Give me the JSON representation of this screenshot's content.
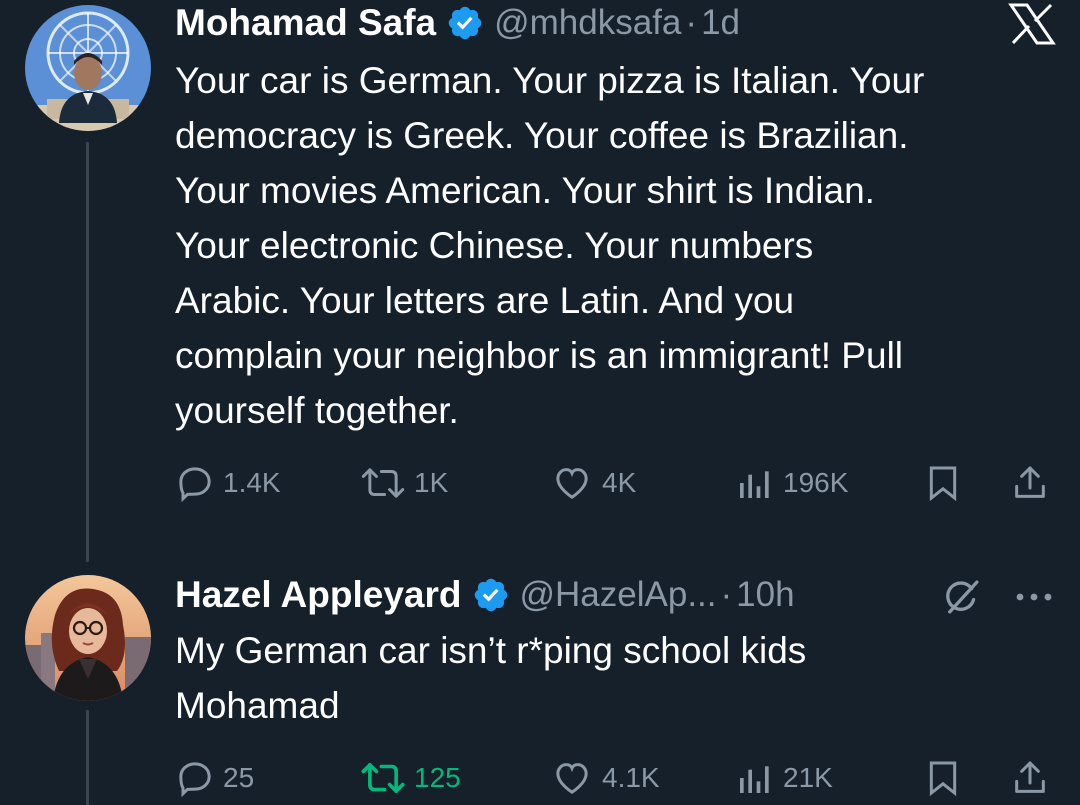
{
  "tweet1": {
    "author_name": "Mohamad Safa",
    "handle": "@mhdksafa",
    "separator": "·",
    "time": "1d",
    "text": "Your car is German. Your pizza is Italian. Your\ndemocracy is Greek. Your coffee is Brazilian.\nYour movies American. Your shirt is Indian.\nYour electronic Chinese. Your numbers\nArabic. Your letters are Latin. And you\ncomplain your neighbor is an immigrant! Pull\nyourself together.",
    "replies": "1.4K",
    "reposts": "1K",
    "likes": "4K",
    "views": "196K",
    "top_right_icon": "x-logo-icon"
  },
  "tweet2": {
    "author_name": "Hazel Appleyard",
    "handle": "@HazelAp...",
    "separator": "·",
    "time": "10h",
    "text": "My German car isn’t r*ping school kids\nMohamad",
    "replies": "25",
    "reposts": "125",
    "likes": "4.1K",
    "views": "21K",
    "reposted_state_color": "#00ba7c",
    "header_icons": [
      "grok-slash-icon",
      "more-icon"
    ]
  },
  "colors": {
    "background": "#15202b",
    "text_primary": "#ffffff",
    "text_secondary": "#8b98a5",
    "verified_blue": "#1d9bf0",
    "repost_green": "#00ba7c",
    "thread_line": "#3a4550"
  }
}
